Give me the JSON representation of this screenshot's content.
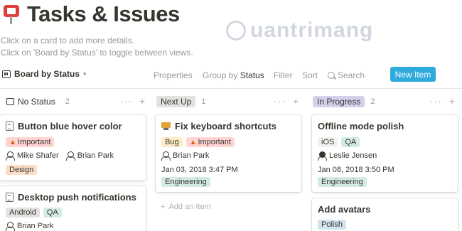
{
  "page": {
    "title": "Tasks & Issues",
    "title_icon": "pushpin-icon",
    "description_line1": "Click on a card to add more details.",
    "description_line2": "Click on 'Board by Status' to toggle between views."
  },
  "watermark": {
    "text": "uantrimang"
  },
  "toolbar": {
    "view_label": "Board by Status",
    "properties": "Properties",
    "group_by_prefix": "Group by",
    "group_by_value": "Status",
    "filter": "Filter",
    "sort": "Sort",
    "search": "Search",
    "new_item": "New Item",
    "accent_color": "#2eaadc"
  },
  "columns": [
    {
      "label": "No Status",
      "count": "2",
      "color": "#ffffff"
    },
    {
      "label": "Next Up",
      "count": "1",
      "color": "#e3e2e0"
    },
    {
      "label": "In Progress",
      "count": "2",
      "color": "#d3d0ec"
    }
  ],
  "cards": {
    "c1": {
      "title": "Button blue hover color",
      "tag1": "Important",
      "person1": "Mike Shafer",
      "person2": "Brian Park",
      "tag2": "Design"
    },
    "c2": {
      "title": "Desktop push notifications",
      "tag1": "Android",
      "tag2": "QA",
      "person1": "Brian Park"
    },
    "c3": {
      "title": "Fix keyboard shortcuts",
      "tag1": "Bug",
      "tag2": "Important",
      "person1": "Brian Park",
      "date": "Jan 03, 2018 3:47 PM",
      "tag3": "Engineering"
    },
    "c4": {
      "title": "Offline mode polish",
      "tag1": "iOS",
      "tag2": "QA",
      "person1": "Leslie Jensen",
      "date": "Jan 08, 2018 3:50 PM",
      "tag3": "Engineering"
    },
    "c5": {
      "title": "Add avatars",
      "tag1": "Polish"
    }
  },
  "add_item": "Add an Item",
  "tag_colors": {
    "Important": "#ffd5d3",
    "Design": "#fadec9",
    "Android": "#e3e2e0",
    "QA": "#d3ebe4",
    "Bug": "#fdecc8",
    "Engineering": "#d3ebe4",
    "iOS": "#f1f1ef",
    "Polish": "#d3e5ef"
  }
}
